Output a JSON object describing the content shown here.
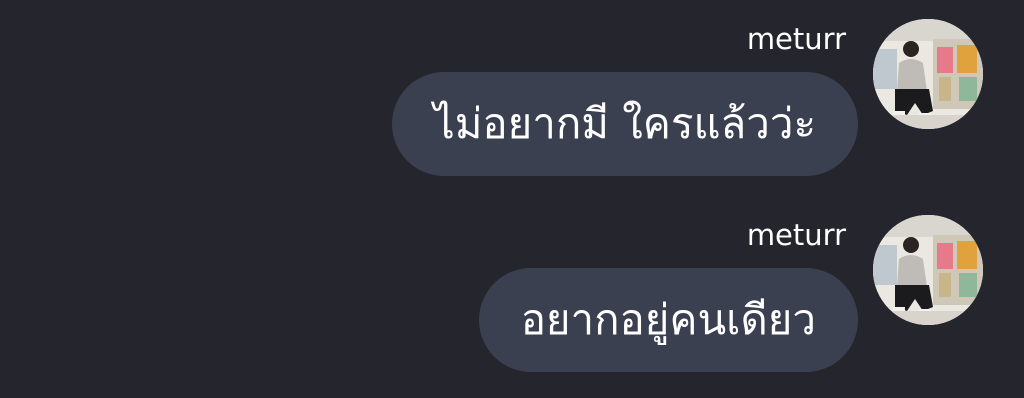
{
  "messages": [
    {
      "sender": "meturr",
      "text": "ไม่อยากมี ใครแล้วว่ะ",
      "avatar_icon": "user-photo-avatar"
    },
    {
      "sender": "meturr",
      "text": "อยากอยู่คนเดียว",
      "avatar_icon": "user-photo-avatar"
    }
  ],
  "colors": {
    "background": "#25252d",
    "bubble": "#3b4050",
    "text": "#ffffff"
  }
}
